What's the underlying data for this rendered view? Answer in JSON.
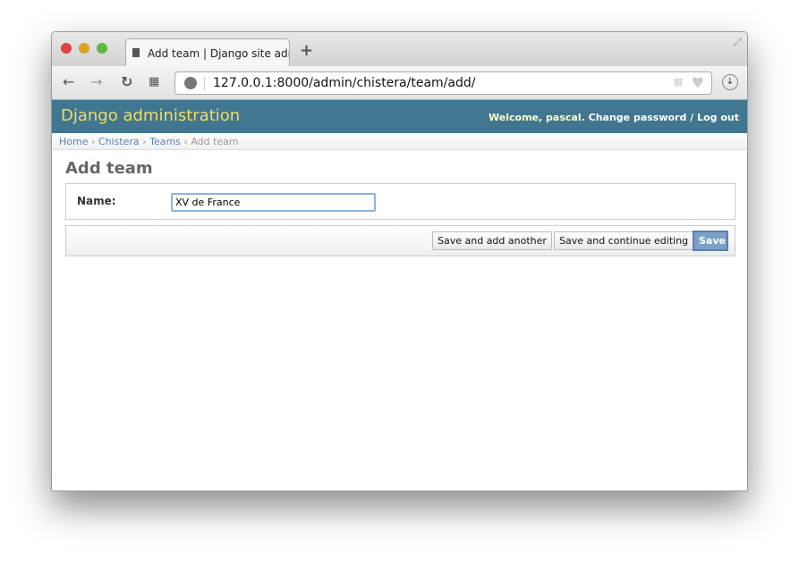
{
  "browser": {
    "tab_title": "Add team | Django site admin",
    "url": "127.0.0.1:8000/admin/chistera/team/add/"
  },
  "header": {
    "brand": "Django administration",
    "welcome": "Welcome,",
    "user": "pascal",
    "change_password": "Change password",
    "separator": "/",
    "logout": "Log out"
  },
  "breadcrumbs": [
    {
      "label": "Home"
    },
    {
      "label": "Chistera"
    },
    {
      "label": "Teams"
    },
    {
      "label": "Add team"
    }
  ],
  "page": {
    "title": "Add team",
    "name_label": "Name:",
    "name_value": "XV de France"
  },
  "buttons": {
    "save_add": "Save and add another",
    "save_continue": "Save and continue editing",
    "save": "Save"
  },
  "colors": {
    "header": "#417690",
    "brand": "#f5dd5d",
    "link": "#5b80b2"
  }
}
